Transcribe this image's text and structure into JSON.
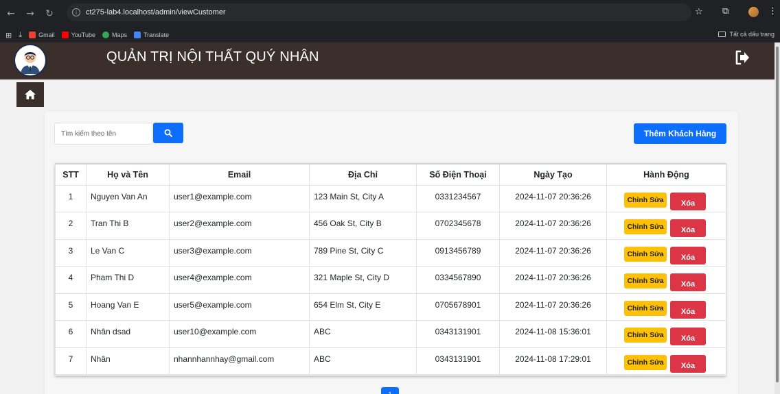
{
  "browser": {
    "url": "ct275-lab4.localhost/admin/viewCustomer",
    "bookmarks": [
      {
        "label": "Gmail",
        "color": "#ea4335"
      },
      {
        "label": "YouTube",
        "color": "#ff0000"
      },
      {
        "label": "Maps",
        "color": "#34a853"
      },
      {
        "label": "Translate",
        "color": "#4285f4"
      }
    ],
    "all_bookmarks": "Tất cả dấu trang"
  },
  "header": {
    "title": "QUẢN TRỊ NỘI THẤT QUÝ NHÂN"
  },
  "toolbar": {
    "search_placeholder": "Tìm kiếm theo tên",
    "add_label": "Thêm Khách Hàng"
  },
  "table": {
    "columns": [
      "STT",
      "Họ và Tên",
      "Email",
      "Địa Chỉ",
      "Số Điện Thoại",
      "Ngày Tạo",
      "Hành Động"
    ],
    "rows": [
      {
        "stt": "1",
        "name": "Nguyen Van An",
        "email": "user1@example.com",
        "address": "123 Main St, City A",
        "phone": "0331234567",
        "created": "2024-11-07 20:36:26"
      },
      {
        "stt": "2",
        "name": "Tran Thi B",
        "email": "user2@example.com",
        "address": "456 Oak St, City B",
        "phone": "0702345678",
        "created": "2024-11-07 20:36:26"
      },
      {
        "stt": "3",
        "name": "Le Van C",
        "email": "user3@example.com",
        "address": "789 Pine St, City C",
        "phone": "0913456789",
        "created": "2024-11-07 20:36:26"
      },
      {
        "stt": "4",
        "name": "Pham Thi D",
        "email": "user4@example.com",
        "address": "321 Maple St, City D",
        "phone": "0334567890",
        "created": "2024-11-07 20:36:26"
      },
      {
        "stt": "5",
        "name": "Hoang Van E",
        "email": "user5@example.com",
        "address": "654 Elm St, City E",
        "phone": "0705678901",
        "created": "2024-11-07 20:36:26"
      },
      {
        "stt": "6",
        "name": "Nhân dsad",
        "email": "user10@example.com",
        "address": "ABC",
        "phone": "0343131901",
        "created": "2024-11-08 15:36:01"
      },
      {
        "stt": "7",
        "name": "Nhân",
        "email": "nhannhannhay@gmail.com",
        "address": "ABC",
        "phone": "0343131901",
        "created": "2024-11-08 17:29:01"
      }
    ],
    "edit_label": "Chỉnh Sửa",
    "delete_label": "Xóa"
  },
  "pagination": {
    "current": "1"
  },
  "colors": {
    "header_bg": "#3b2f2b",
    "primary": "#0d6efd",
    "warning": "#ffc107",
    "danger": "#dc3545"
  }
}
